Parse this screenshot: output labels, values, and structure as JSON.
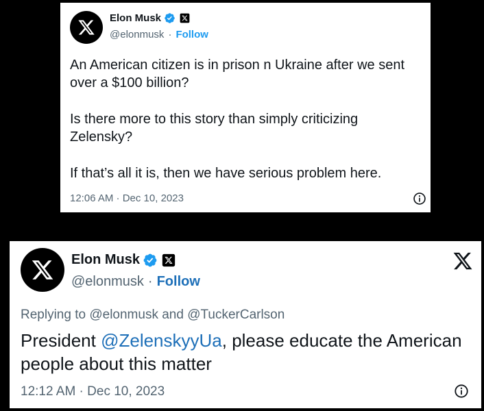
{
  "tweet1": {
    "author_name": "Elon Musk",
    "handle": "@elonmusk",
    "separator": "·",
    "follow_label": "Follow",
    "paragraphs": [
      "An American citizen is in prison n Ukraine after we sent over a $100 billion?",
      "Is there more to this story than simply criticizing Zelensky?",
      "If that’s all it is, then we have serious problem here."
    ],
    "timestamp": "12:06 AM · Dec 10, 2023",
    "avatar_icon": "x-logo-avatar-icon",
    "verified_icon": "verified-badge-icon",
    "affiliate_icon": "x-affiliate-badge-icon",
    "info_icon": "info-icon"
  },
  "tweet2": {
    "author_name": "Elon Musk",
    "handle": "@elonmusk",
    "separator": "·",
    "follow_label": "Follow",
    "reply_context": "Replying to @elonmusk and @TuckerCarlson",
    "text_before": "President ",
    "mention": "@ZelenskyyUa",
    "text_after": ", please educate the American people about this matter",
    "timestamp": "12:12 AM · Dec 10, 2023",
    "avatar_icon": "x-logo-avatar-icon",
    "verified_icon": "verified-badge-icon",
    "affiliate_icon": "x-affiliate-badge-icon",
    "x_logo_icon": "x-logo-icon",
    "info_icon": "info-icon"
  },
  "colors": {
    "background": "#000000",
    "card": "#ffffff",
    "text": "#0f1419",
    "secondary": "#536471",
    "link": "#1d9bf0",
    "verified": "#1d9bf0"
  }
}
